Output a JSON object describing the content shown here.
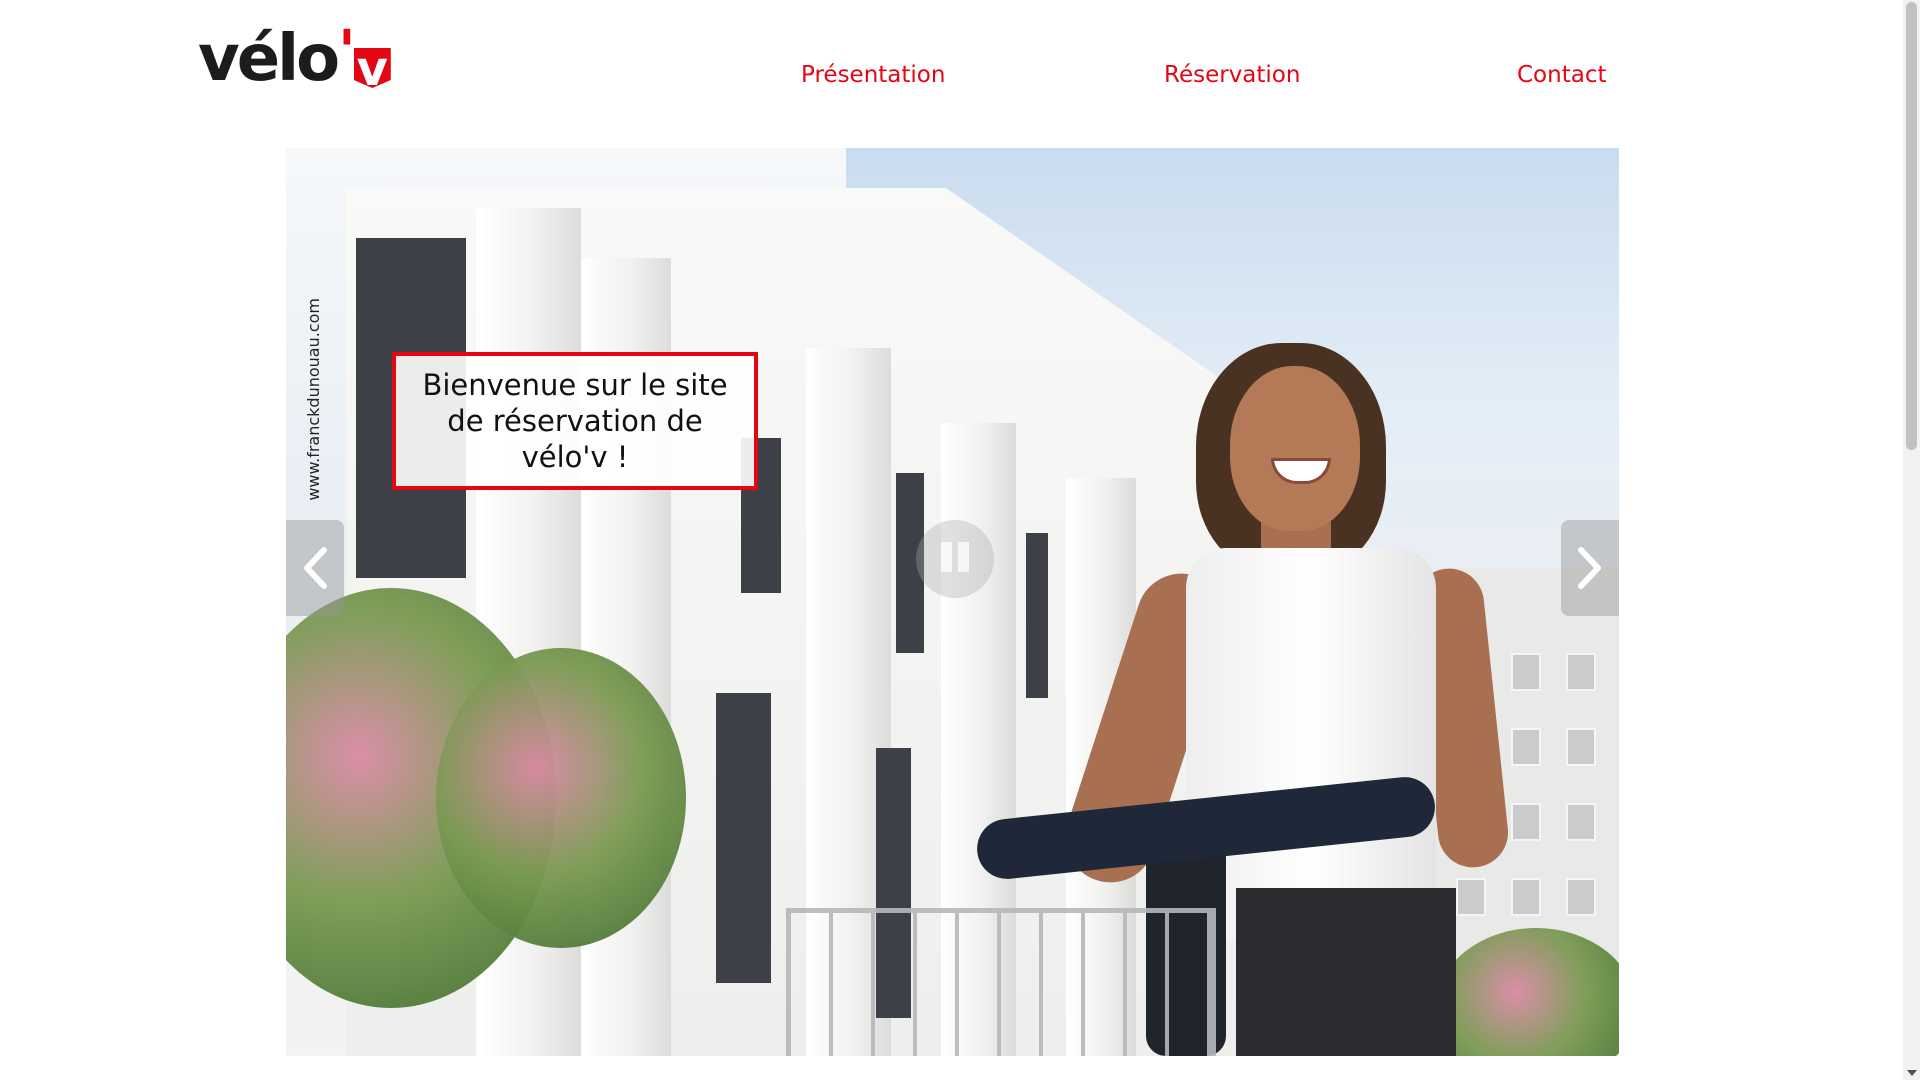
{
  "logo": {
    "text_main": "vélo",
    "text_apostrophe": "'",
    "text_v": "v",
    "accent_color": "#e30613"
  },
  "nav": {
    "items": [
      {
        "label": "Présentation"
      },
      {
        "label": "Réservation"
      },
      {
        "label": "Contact"
      }
    ],
    "color": "#e30613"
  },
  "hero": {
    "welcome_text": "Bienvenue sur le site de réservation de vélo'v !",
    "photo_credit": "www.franckdunouau.com",
    "controls": {
      "prev_icon": "chevron-left-icon",
      "next_icon": "chevron-right-icon",
      "pause_icon": "pause-icon"
    }
  },
  "scrollbar": {
    "down_icon": "chevron-down-icon"
  }
}
